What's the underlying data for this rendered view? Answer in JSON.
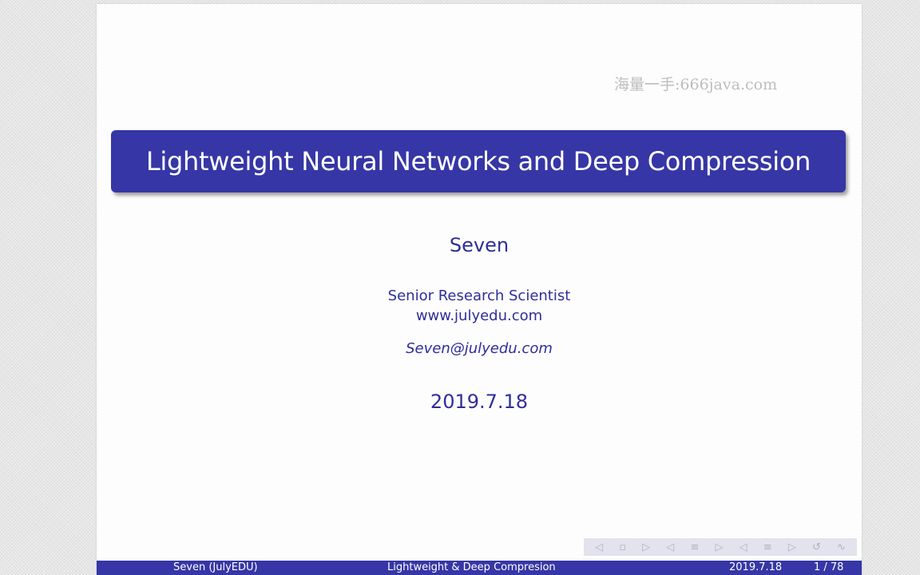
{
  "watermark": "海量一手:666java.com",
  "slide": {
    "title": "Lightweight Neural Networks and Deep Compression",
    "author": "Seven",
    "job_title": "Senior Research Scientist",
    "website": "www.julyedu.com",
    "email": "Seven@julyedu.com",
    "date": "2019.7.18"
  },
  "footer": {
    "author": "Seven (JulyEDU)",
    "short_title": "Lightweight & Deep Compresion",
    "date": "2019.7.18",
    "page": "1 / 78"
  },
  "nav_icons": {
    "first": "◁",
    "prev": "◂",
    "frame_prev": "◁",
    "frame": "▫",
    "frame_next": "▷",
    "section_prev": "◁",
    "section": "≡",
    "section_next": "▷",
    "subsection_prev": "◁",
    "subsection": "≡",
    "subsection_next": "▷",
    "back": "↺",
    "search": "∿"
  },
  "colors": {
    "accent": "#3636a6",
    "text": "#2e2e9a",
    "watermark": "#bdbdbd"
  }
}
